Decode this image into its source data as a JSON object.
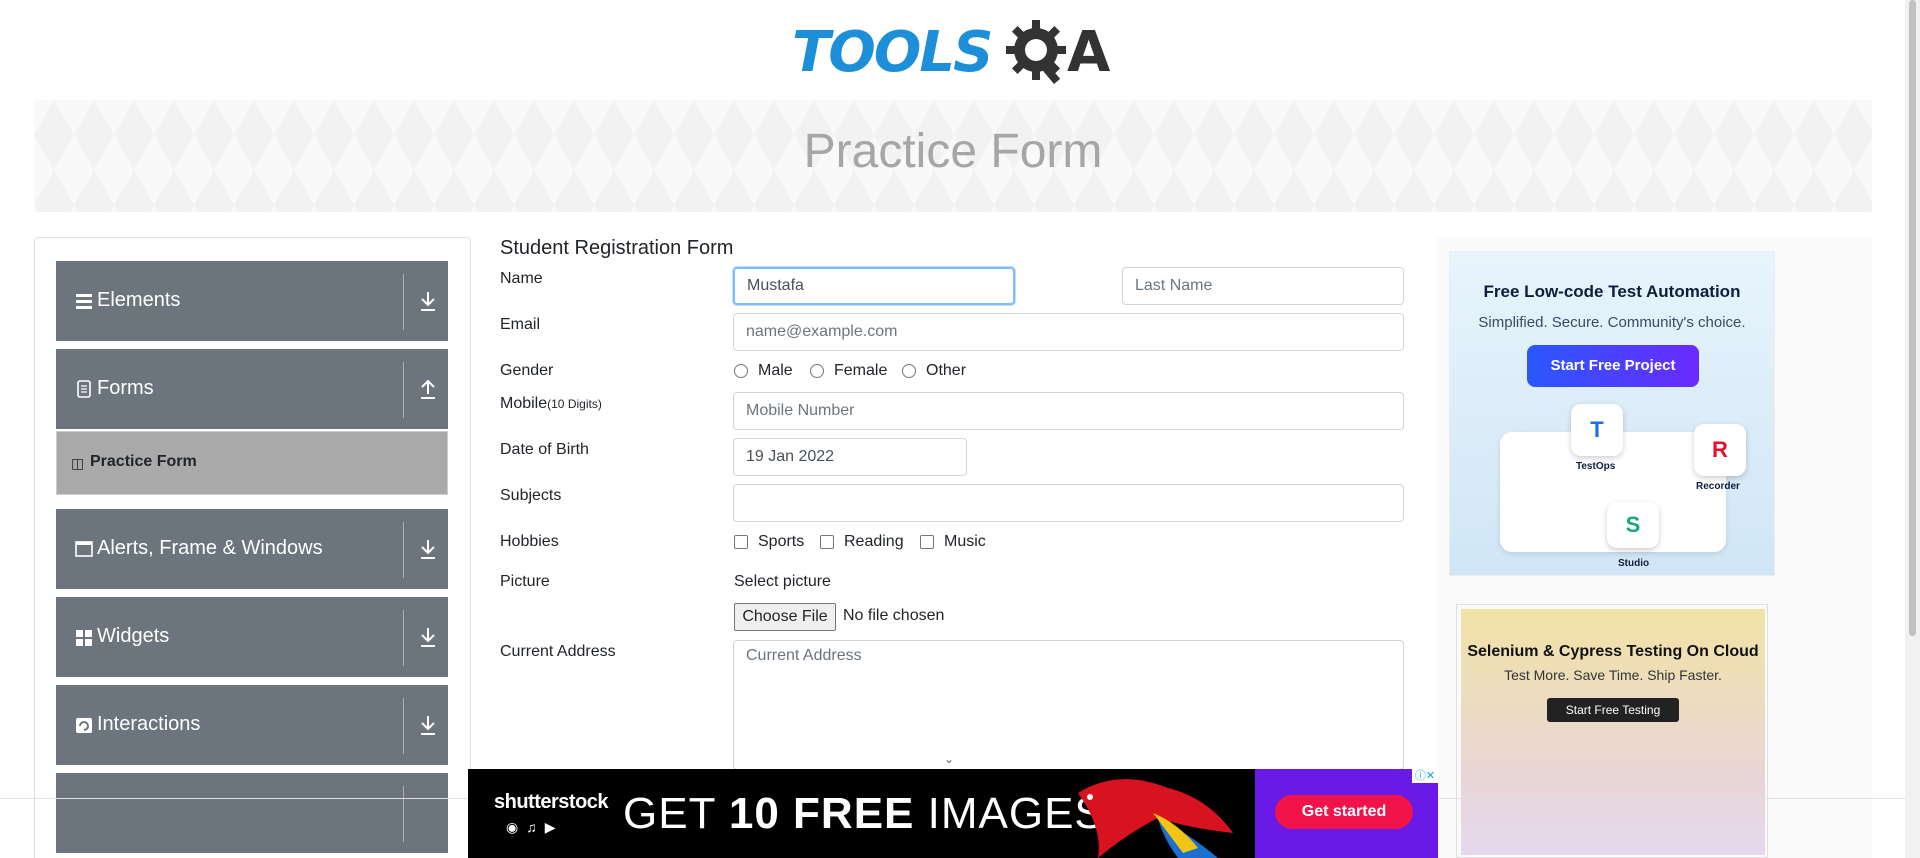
{
  "header": {
    "logo_text": "TOOLS",
    "logo_suffix": "A"
  },
  "banner": {
    "title": "Practice Form"
  },
  "sidebar": {
    "groups": [
      {
        "label": "Elements",
        "icon": "list-icon",
        "arrow": "download"
      },
      {
        "label": "Forms",
        "icon": "document-icon",
        "arrow": "upload"
      },
      {
        "label": "Alerts, Frame & Windows",
        "icon": "window-icon",
        "arrow": "download"
      },
      {
        "label": "Widgets",
        "icon": "widgets-icon",
        "arrow": "download"
      },
      {
        "label": "Interactions",
        "icon": "interactions-icon",
        "arrow": "download"
      }
    ],
    "active_item": "Practice Form"
  },
  "form": {
    "title": "Student Registration Form",
    "labels": {
      "name": "Name",
      "email": "Email",
      "gender": "Gender",
      "mobile": "Mobile",
      "mobile_hint": "(10 Digits)",
      "dob": "Date of Birth",
      "subjects": "Subjects",
      "hobbies": "Hobbies",
      "picture": "Picture",
      "address": "Current Address"
    },
    "first_name_value": "Mustafa",
    "last_name_placeholder": "Last Name",
    "email_placeholder": "name@example.com",
    "genders": [
      "Male",
      "Female",
      "Other"
    ],
    "mobile_placeholder": "Mobile Number",
    "dob_value": "19 Jan 2022",
    "subjects_value": "",
    "hobbies": [
      "Sports",
      "Reading",
      "Music"
    ],
    "select_picture": "Select picture",
    "choose_file": "Choose File",
    "no_file": "No file chosen",
    "address_placeholder": "Current Address"
  },
  "ads": {
    "katalon": {
      "title": "Free Low-code Test Automation",
      "subtitle": "Simplified. Secure. Community's choice.",
      "button": "Start Free Project",
      "tags": [
        "TestOps",
        "Recorder",
        "Studio"
      ]
    },
    "lambdatest": {
      "title": "Selenium & Cypress Testing On Cloud",
      "subtitle": "Test More. Save Time. Ship Faster.",
      "button": "Start Free Testing"
    },
    "shutterstock": {
      "brand": "shutterstock",
      "headline_part1": "GET ",
      "headline_bold": "10 FREE",
      "headline_part2": " IMAGES",
      "button": "Get started"
    }
  },
  "colors": {
    "sidebar_group": "#6c757d",
    "active_item": "#aaaaaa",
    "logo_blue": "#1d8fd8"
  }
}
